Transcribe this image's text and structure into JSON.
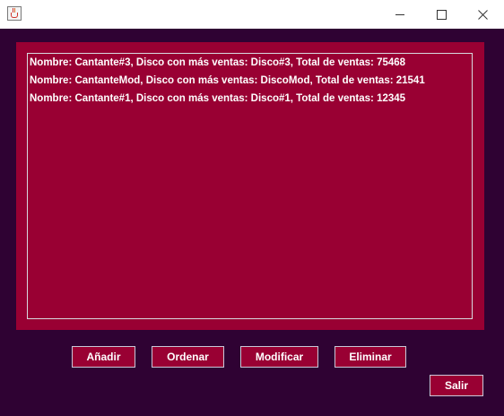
{
  "window": {
    "title": "",
    "icon": "java-cup-icon",
    "controls": [
      "minimize",
      "maximize",
      "close"
    ]
  },
  "colors": {
    "background": "#2f0233",
    "panel": "#990033",
    "text": "#ffffff"
  },
  "list": {
    "lines": [
      "Nombre: Cantante#3, Disco con más ventas: Disco#3, Total de ventas: 75468",
      "Nombre: CantanteMod, Disco con más ventas: DiscoMod, Total de ventas: 21541",
      "Nombre: Cantante#1, Disco con más ventas: Disco#1, Total de ventas: 12345"
    ]
  },
  "buttons": {
    "add": "Añadir",
    "sort": "Ordenar",
    "modify": "Modificar",
    "delete": "Eliminar",
    "exit": "Salir"
  }
}
